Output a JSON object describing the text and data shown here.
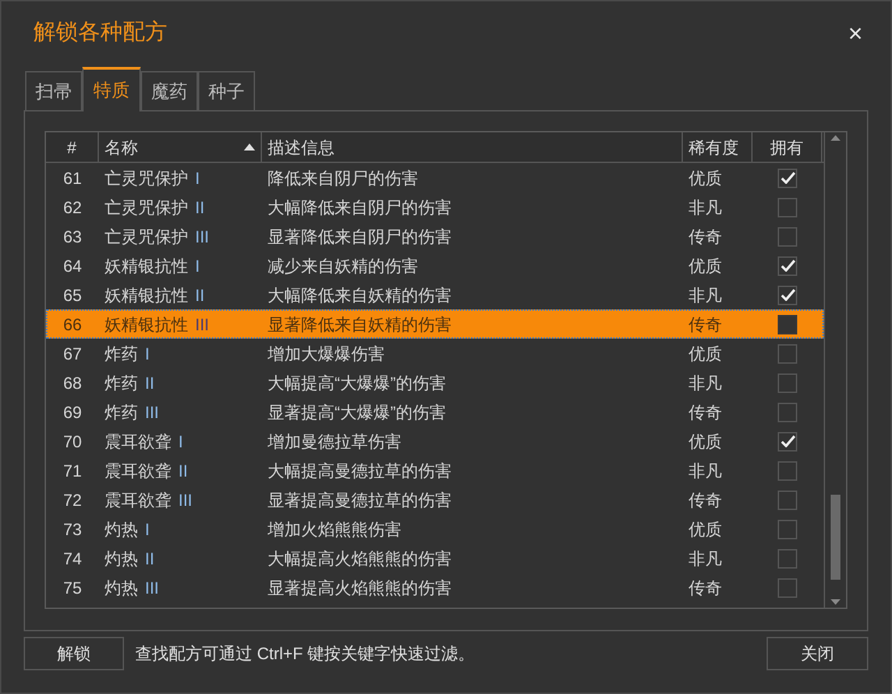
{
  "window": {
    "title": "解锁各种配方",
    "close": "×"
  },
  "tabs": [
    {
      "label": "扫帚",
      "selected": false
    },
    {
      "label": "特质",
      "selected": true
    },
    {
      "label": "魔药",
      "selected": false
    },
    {
      "label": "种子",
      "selected": false
    }
  ],
  "table": {
    "columns": [
      {
        "label": "#",
        "sorted": false
      },
      {
        "label": "名称",
        "sorted": true
      },
      {
        "label": "描述信息",
        "sorted": false
      },
      {
        "label": "稀有度",
        "sorted": false
      },
      {
        "label": "拥有",
        "sorted": false
      }
    ],
    "rows": [
      {
        "number": "61",
        "name": "亡灵咒保护",
        "rank": "I",
        "description": "降低来自阴尸的伤害",
        "rarity": "优质",
        "owned": true,
        "selected": false
      },
      {
        "number": "62",
        "name": "亡灵咒保护",
        "rank": "II",
        "description": "大幅降低来自阴尸的伤害",
        "rarity": "非凡",
        "owned": false,
        "selected": false
      },
      {
        "number": "63",
        "name": "亡灵咒保护",
        "rank": "III",
        "description": "显著降低来自阴尸的伤害",
        "rarity": "传奇",
        "owned": false,
        "selected": false
      },
      {
        "number": "64",
        "name": "妖精银抗性",
        "rank": "I",
        "description": "减少来自妖精的伤害",
        "rarity": "优质",
        "owned": true,
        "selected": false
      },
      {
        "number": "65",
        "name": "妖精银抗性",
        "rank": "II",
        "description": "大幅降低来自妖精的伤害",
        "rarity": "非凡",
        "owned": true,
        "selected": false
      },
      {
        "number": "66",
        "name": "妖精银抗性",
        "rank": "III",
        "description": "显著降低来自妖精的伤害",
        "rarity": "传奇",
        "owned": false,
        "selected": true
      },
      {
        "number": "67",
        "name": "炸药",
        "rank": "I",
        "description": "增加大爆爆伤害",
        "rarity": "优质",
        "owned": false,
        "selected": false
      },
      {
        "number": "68",
        "name": "炸药",
        "rank": "II",
        "description": "大幅提高“大爆爆”的伤害",
        "rarity": "非凡",
        "owned": false,
        "selected": false
      },
      {
        "number": "69",
        "name": "炸药",
        "rank": "III",
        "description": "显著提高“大爆爆”的伤害",
        "rarity": "传奇",
        "owned": false,
        "selected": false
      },
      {
        "number": "70",
        "name": "震耳欲聋",
        "rank": "I",
        "description": "增加曼德拉草伤害",
        "rarity": "优质",
        "owned": true,
        "selected": false
      },
      {
        "number": "71",
        "name": "震耳欲聋",
        "rank": "II",
        "description": "大幅提高曼德拉草的伤害",
        "rarity": "非凡",
        "owned": false,
        "selected": false
      },
      {
        "number": "72",
        "name": "震耳欲聋",
        "rank": "III",
        "description": "显著提高曼德拉草的伤害",
        "rarity": "传奇",
        "owned": false,
        "selected": false
      },
      {
        "number": "73",
        "name": "灼热",
        "rank": "I",
        "description": "增加火焰熊熊伤害",
        "rarity": "优质",
        "owned": false,
        "selected": false
      },
      {
        "number": "74",
        "name": "灼热",
        "rank": "II",
        "description": "大幅提高火焰熊熊的伤害",
        "rarity": "非凡",
        "owned": false,
        "selected": false
      },
      {
        "number": "75",
        "name": "灼热",
        "rank": "III",
        "description": "显著提高火焰熊熊的伤害",
        "rarity": "传奇",
        "owned": false,
        "selected": false
      }
    ]
  },
  "footer": {
    "unlock_button": "解锁",
    "hint": "查找配方可通过 Ctrl+F 键按关键字快速过滤。",
    "close_button": "关闭"
  }
}
